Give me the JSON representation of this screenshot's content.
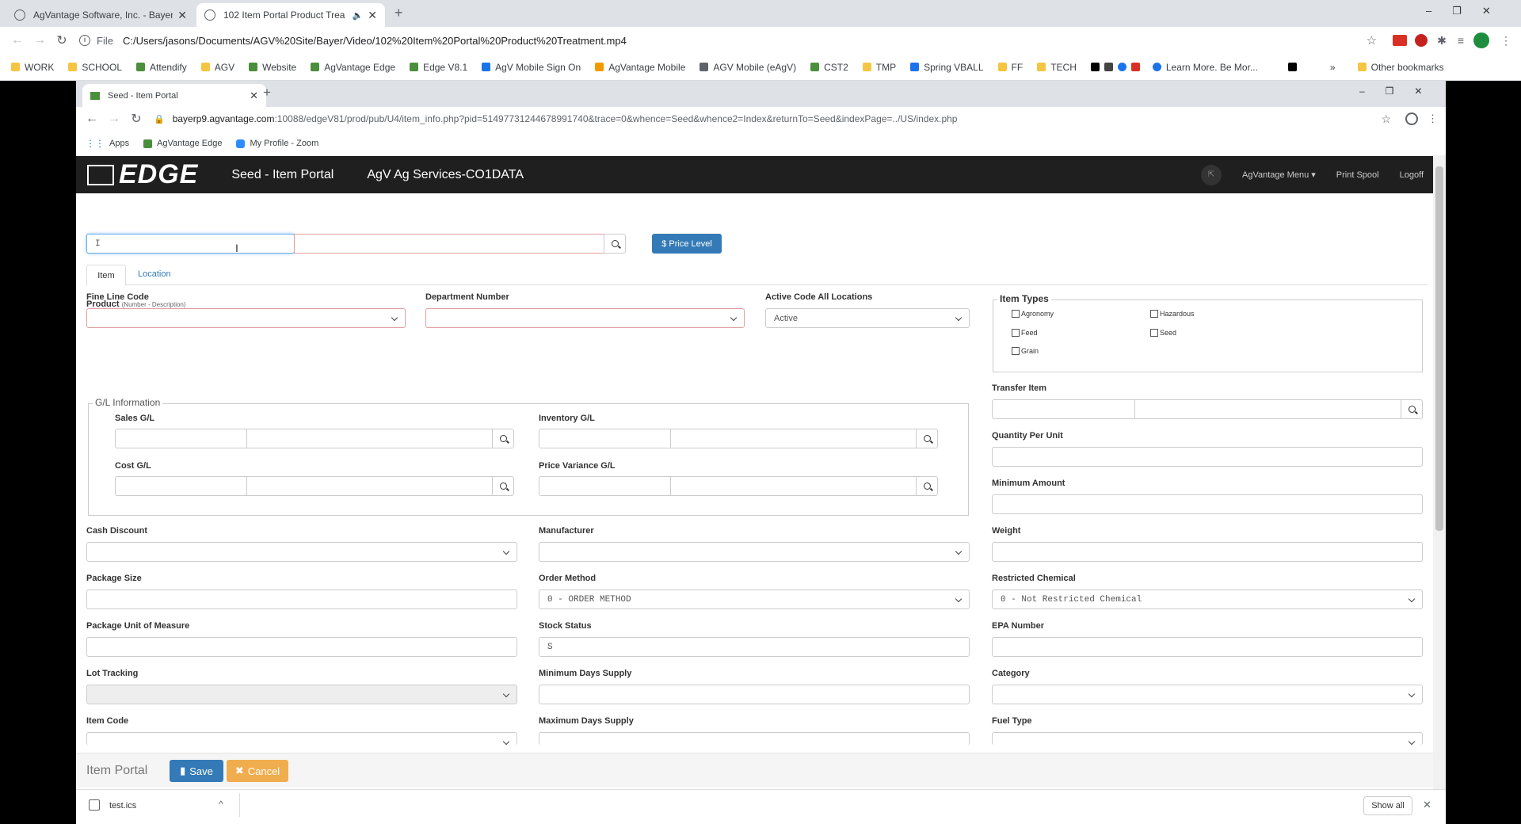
{
  "outer": {
    "tab1": "AgVantage Software, Inc. - Bayer",
    "tab2": "102 Item Portal Product Trea",
    "url_prefix": "File",
    "url": "C:/Users/jasons/Documents/AGV%20Site/Bayer/Video/102%20Item%20Portal%20Product%20Treatment.mp4",
    "bookmarks": [
      "WORK",
      "SCHOOL",
      "Attendify",
      "AGV",
      "Website",
      "AgVantage Edge",
      "Edge V8.1",
      "AgV Mobile Sign On",
      "AgVantage Mobile",
      "AGV Mobile (eAgV)",
      "CST2",
      "TMP",
      "Spring VBALL",
      "FF",
      "TECH",
      "Learn More. Be Mor..."
    ],
    "other_bookmarks": "Other bookmarks"
  },
  "inner": {
    "tab": "Seed - Item Portal",
    "url_host": "bayerp9.agvantage.com",
    "url_rest": ":10088/edgeV81/prod/pub/U4/item_info.php?pid=51497731244678991740&trace=0&whence=Seed&whence2=Index&returnTo=Seed&indexPage=../US/index.php",
    "bookmarks": [
      "Apps",
      "AgVantage Edge",
      "My Profile - Zoom"
    ]
  },
  "app": {
    "logo": "EDGE",
    "title": "Seed - Item Portal",
    "company": "AgV Ag Services-CO1DATA",
    "menu": "AgVantage Menu",
    "print_spool": "Print Spool",
    "logoff": "Logoff"
  },
  "form": {
    "product_label": "Product",
    "product_hint": "(Number - Description)",
    "product_value": "I",
    "price_level": "$ Price Level",
    "tabs": [
      "Item",
      "Location"
    ],
    "fine_line_code": "Fine Line Code",
    "department_number": "Department Number",
    "active_code": "Active Code All Locations",
    "active_value": "Active",
    "item_types": "Item Types",
    "types": [
      "Agronomy",
      "Hazardous",
      "Feed",
      "Seed",
      "Grain"
    ],
    "gl_info": "G/L Information",
    "sales_gl": "Sales G/L",
    "inventory_gl": "Inventory G/L",
    "cost_gl": "Cost G/L",
    "price_variance_gl": "Price Variance G/L",
    "transfer_item": "Transfer Item",
    "quantity_per_unit": "Quantity Per Unit",
    "minimum_amount": "Minimum Amount",
    "cash_discount": "Cash Discount",
    "manufacturer": "Manufacturer",
    "weight": "Weight",
    "package_size": "Package Size",
    "order_method": "Order Method",
    "order_method_value": "0 - ORDER METHOD",
    "restricted_chemical": "Restricted Chemical",
    "restricted_value": "0 - Not Restricted Chemical",
    "package_uom": "Package Unit of Measure",
    "stock_status": "Stock Status",
    "stock_status_value": "S",
    "epa_number": "EPA Number",
    "lot_tracking": "Lot Tracking",
    "min_days_supply": "Minimum Days Supply",
    "category": "Category",
    "item_code": "Item Code",
    "max_days_supply": "Maximum Days Supply",
    "fuel_type": "Fuel Type"
  },
  "footer": {
    "title": "Item Portal",
    "save": "Save",
    "cancel": "Cancel"
  },
  "downloads": {
    "file": "test.ics",
    "show_all": "Show all"
  }
}
